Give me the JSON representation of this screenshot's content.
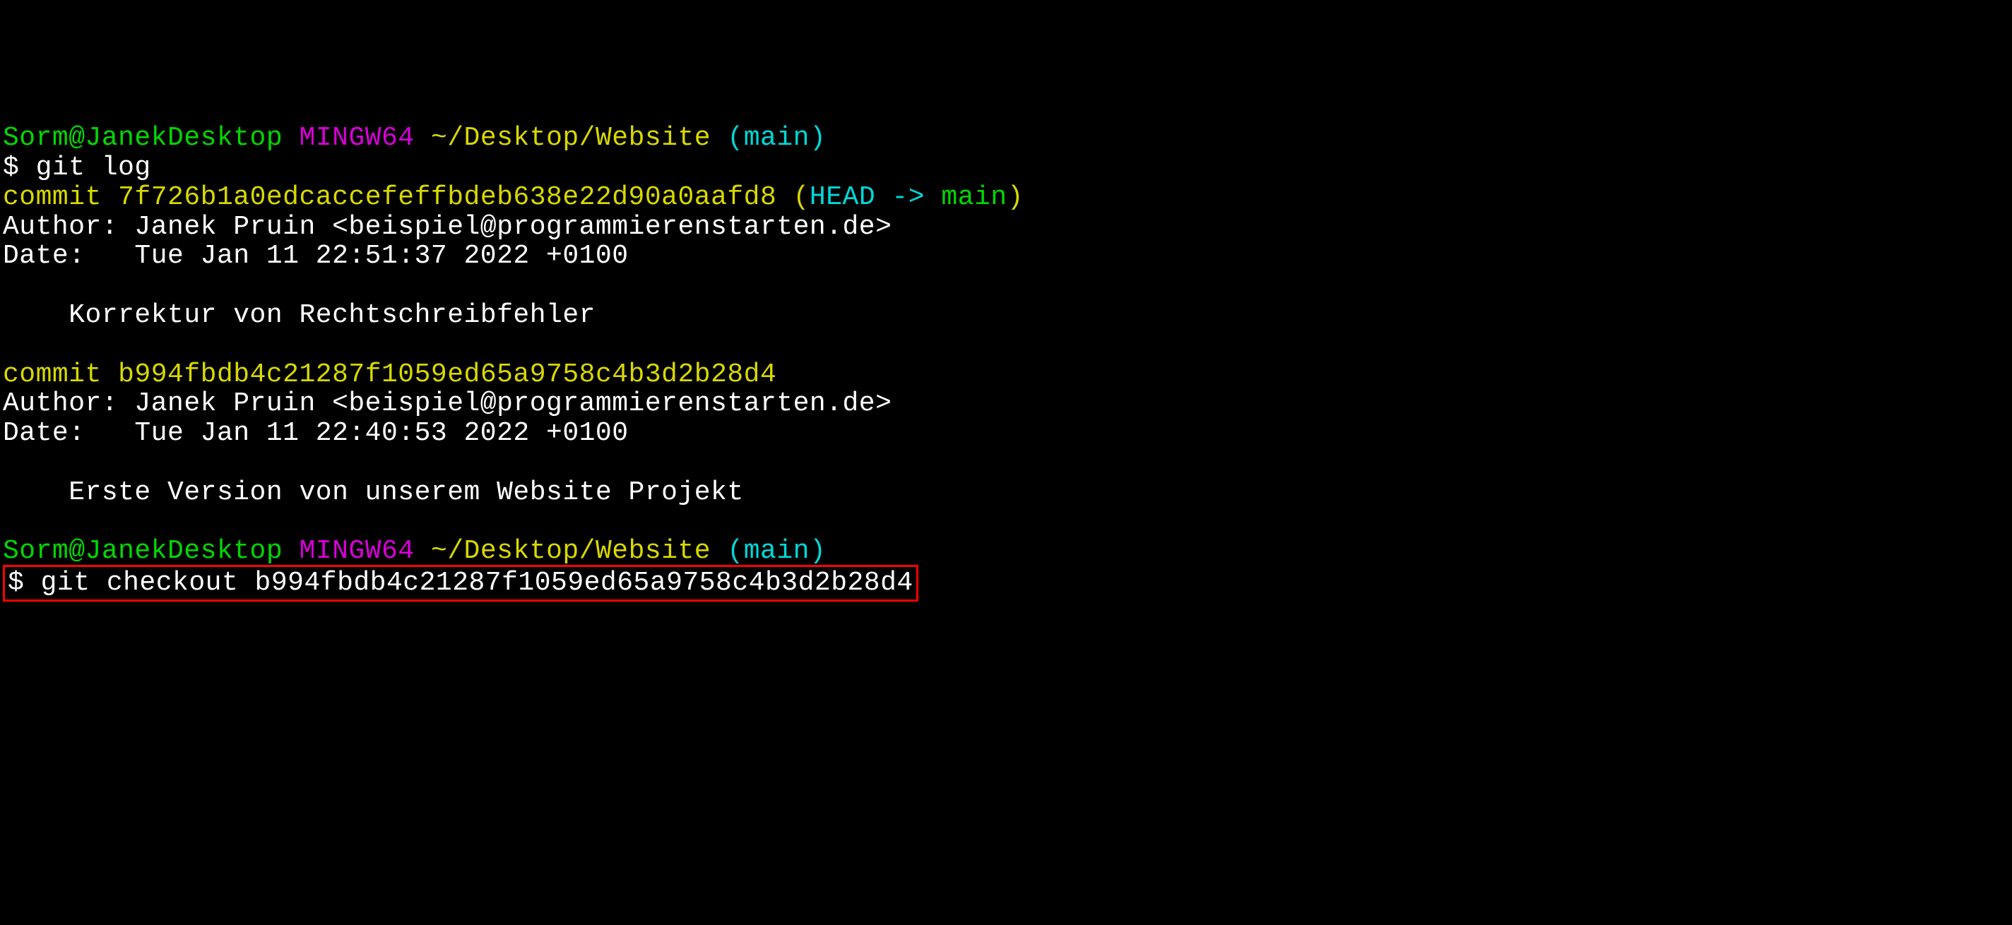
{
  "prompt1": {
    "user_host": "Sorm@JanekDesktop",
    "shell": "MINGW64",
    "path": "~/Desktop/Website",
    "branch": "(main)"
  },
  "cmd1": {
    "dollar": "$ ",
    "command": "git log"
  },
  "commit1": {
    "prefix": "commit ",
    "hash": "7f726b1a0edcaccefeffbdeb638e22d90a0aafd8",
    "paren_open": " (",
    "head": "HEAD -> ",
    "branch": "main",
    "paren_close": ")"
  },
  "author1": "Author: Janek Pruin <beispiel@programmierenstarten.de>",
  "date1": "Date:   Tue Jan 11 22:51:37 2022 +0100",
  "msg1": "    Korrektur von Rechtschreibfehler",
  "commit2": {
    "prefix": "commit ",
    "hash": "b994fbdb4c21287f1059ed65a9758c4b3d2b28d4"
  },
  "author2": "Author: Janek Pruin <beispiel@programmierenstarten.de>",
  "date2": "Date:   Tue Jan 11 22:40:53 2022 +0100",
  "msg2": "    Erste Version von unserem Website Projekt",
  "prompt2": {
    "user_host": "Sorm@JanekDesktop",
    "shell": "MINGW64",
    "path": "~/Desktop/Website",
    "branch": "(main)"
  },
  "cmd2": {
    "dollar": "$ ",
    "command": "git checkout b994fbdb4c21287f1059ed65a9758c4b3d2b28d4"
  }
}
